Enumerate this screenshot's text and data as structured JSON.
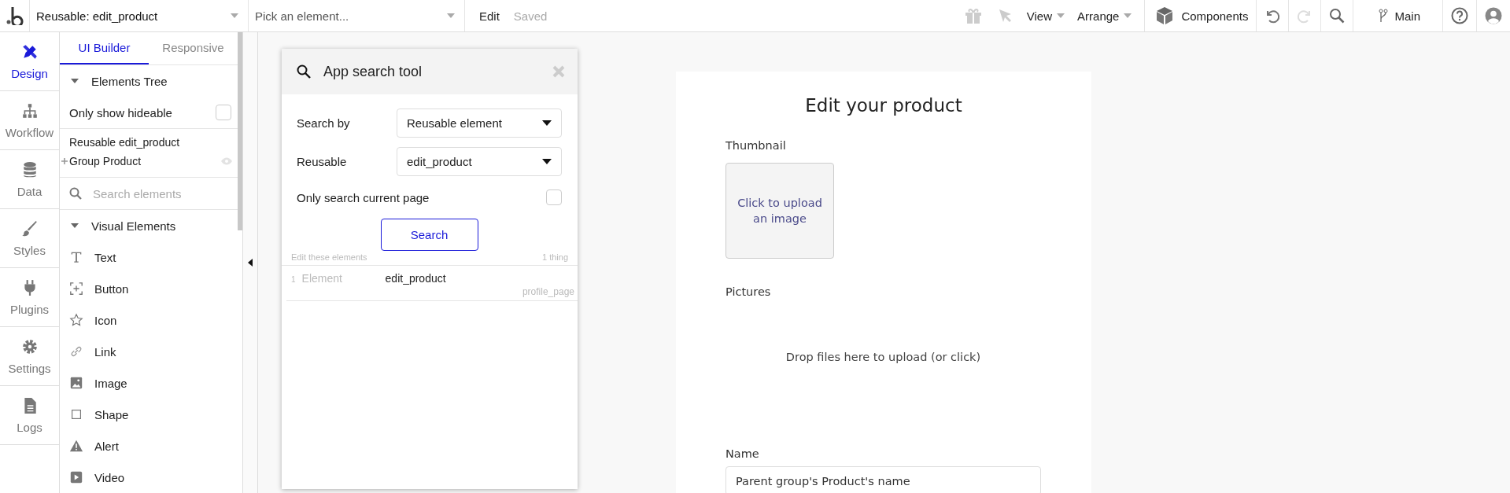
{
  "top_bar": {
    "page_selector": "Reusable: edit_product",
    "element_picker": {
      "placeholder": "Pick an element..."
    },
    "mode": "Edit",
    "save_status": "Saved",
    "menus": [
      {
        "label": "View"
      },
      {
        "label": "Arrange"
      }
    ],
    "components": "Components",
    "branch": "Main"
  },
  "nav_rail": [
    {
      "label": "Design",
      "selected": true
    },
    {
      "label": "Workflow",
      "selected": false
    },
    {
      "label": "Data",
      "selected": false
    },
    {
      "label": "Styles",
      "selected": false
    },
    {
      "label": "Plugins",
      "selected": false
    },
    {
      "label": "Settings",
      "selected": false
    },
    {
      "label": "Logs",
      "selected": false
    }
  ],
  "sidebar": {
    "tabs": [
      {
        "label": "UI Builder",
        "selected": true
      },
      {
        "label": "Responsive",
        "selected": false
      }
    ],
    "elements_tree": {
      "title": "Elements Tree",
      "expanded": true,
      "only_show_hideable": {
        "label": "Only show hideable",
        "checked": false
      },
      "tree": [
        {
          "label": "Reusable edit_product",
          "children": [
            {
              "label": "Group Product",
              "expanded": false,
              "visible": true
            }
          ]
        }
      ]
    },
    "search": {
      "placeholder": "Search elements"
    },
    "visual_elements": {
      "title": "Visual Elements",
      "expanded": true,
      "items": [
        {
          "label": "Text"
        },
        {
          "label": "Button"
        },
        {
          "label": "Icon"
        },
        {
          "label": "Link"
        },
        {
          "label": "Image"
        },
        {
          "label": "Shape"
        },
        {
          "label": "Alert"
        },
        {
          "label": "Video"
        }
      ]
    }
  },
  "search_tool": {
    "title": "App search tool",
    "fields": [
      {
        "label": "Search by",
        "value": "Reusable element"
      },
      {
        "label": "Reusable",
        "value": "edit_product"
      }
    ],
    "only_current_page": {
      "label": "Only search current page",
      "checked": false
    },
    "button": "Search",
    "results_header": "Edit these elements",
    "count": "1 thing",
    "results": [
      {
        "index": "1",
        "type": "Element",
        "name": "edit_product",
        "page": "profile_page"
      }
    ]
  },
  "canvas": {
    "title": "Edit your product",
    "thumbnail_label": "Thumbnail",
    "uploader": "Click to upload an image",
    "pictures_label": "Pictures",
    "dropzone": "Drop files here to upload (or click)",
    "name_label": "Name",
    "name_field": {
      "value": "Parent group's Product's name"
    }
  }
}
